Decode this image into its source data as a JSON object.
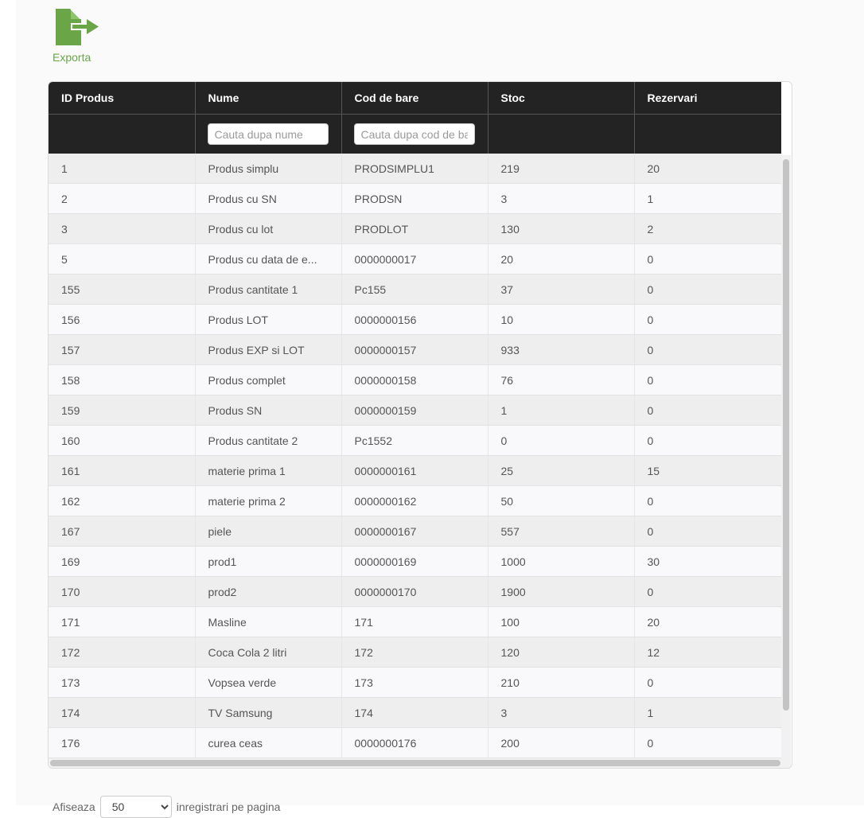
{
  "export": {
    "label": "Exporta",
    "icon": "file-export-icon",
    "color": "#6aa548"
  },
  "table": {
    "columns": [
      "ID Produs",
      "Nume",
      "Cod de bare",
      "Stoc",
      "Rezervari"
    ],
    "filters": {
      "name_placeholder": "Cauta dupa nume",
      "barcode_placeholder": "Cauta dupa cod de bare"
    },
    "rows": [
      [
        "1",
        "Produs simplu",
        "PRODSIMPLU1",
        "219",
        "20"
      ],
      [
        "2",
        "Produs cu SN",
        "PRODSN",
        "3",
        "1"
      ],
      [
        "3",
        "Produs cu lot",
        "PRODLOT",
        "130",
        "2"
      ],
      [
        "5",
        "Produs cu data de e...",
        "0000000017",
        "20",
        "0"
      ],
      [
        "155",
        "Produs cantitate 1",
        "Pc155",
        "37",
        "0"
      ],
      [
        "156",
        "Produs LOT",
        "0000000156",
        "10",
        "0"
      ],
      [
        "157",
        "Produs EXP si LOT",
        "0000000157",
        "933",
        "0"
      ],
      [
        "158",
        "Produs complet",
        "0000000158",
        "76",
        "0"
      ],
      [
        "159",
        "Produs SN",
        "0000000159",
        "1",
        "0"
      ],
      [
        "160",
        "Produs cantitate 2",
        "Pc1552",
        "0",
        "0"
      ],
      [
        "161",
        "materie prima 1",
        "0000000161",
        "25",
        "15"
      ],
      [
        "162",
        "materie prima 2",
        "0000000162",
        "50",
        "0"
      ],
      [
        "167",
        "piele",
        "0000000167",
        "557",
        "0"
      ],
      [
        "169",
        "prod1",
        "0000000169",
        "1000",
        "30"
      ],
      [
        "170",
        "prod2",
        "0000000170",
        "1900",
        "0"
      ],
      [
        "171",
        "Masline",
        "171",
        "100",
        "20"
      ],
      [
        "172",
        "Coca Cola 2 litri",
        "172",
        "120",
        "12"
      ],
      [
        "173",
        "Vopsea verde",
        "173",
        "210",
        "0"
      ],
      [
        "174",
        "TV Samsung",
        "174",
        "3",
        "1"
      ],
      [
        "176",
        "curea ceas",
        "0000000176",
        "200",
        "0"
      ],
      [
        "",
        "",
        "",
        "",
        ""
      ]
    ]
  },
  "footer": {
    "prefix": "Afiseaza",
    "page_size": "50",
    "suffix": "inregistrari pe pagina"
  },
  "colors": {
    "header_bg": "#232323",
    "row_odd": "#eeeeee",
    "row_even": "#f9f9fb"
  }
}
